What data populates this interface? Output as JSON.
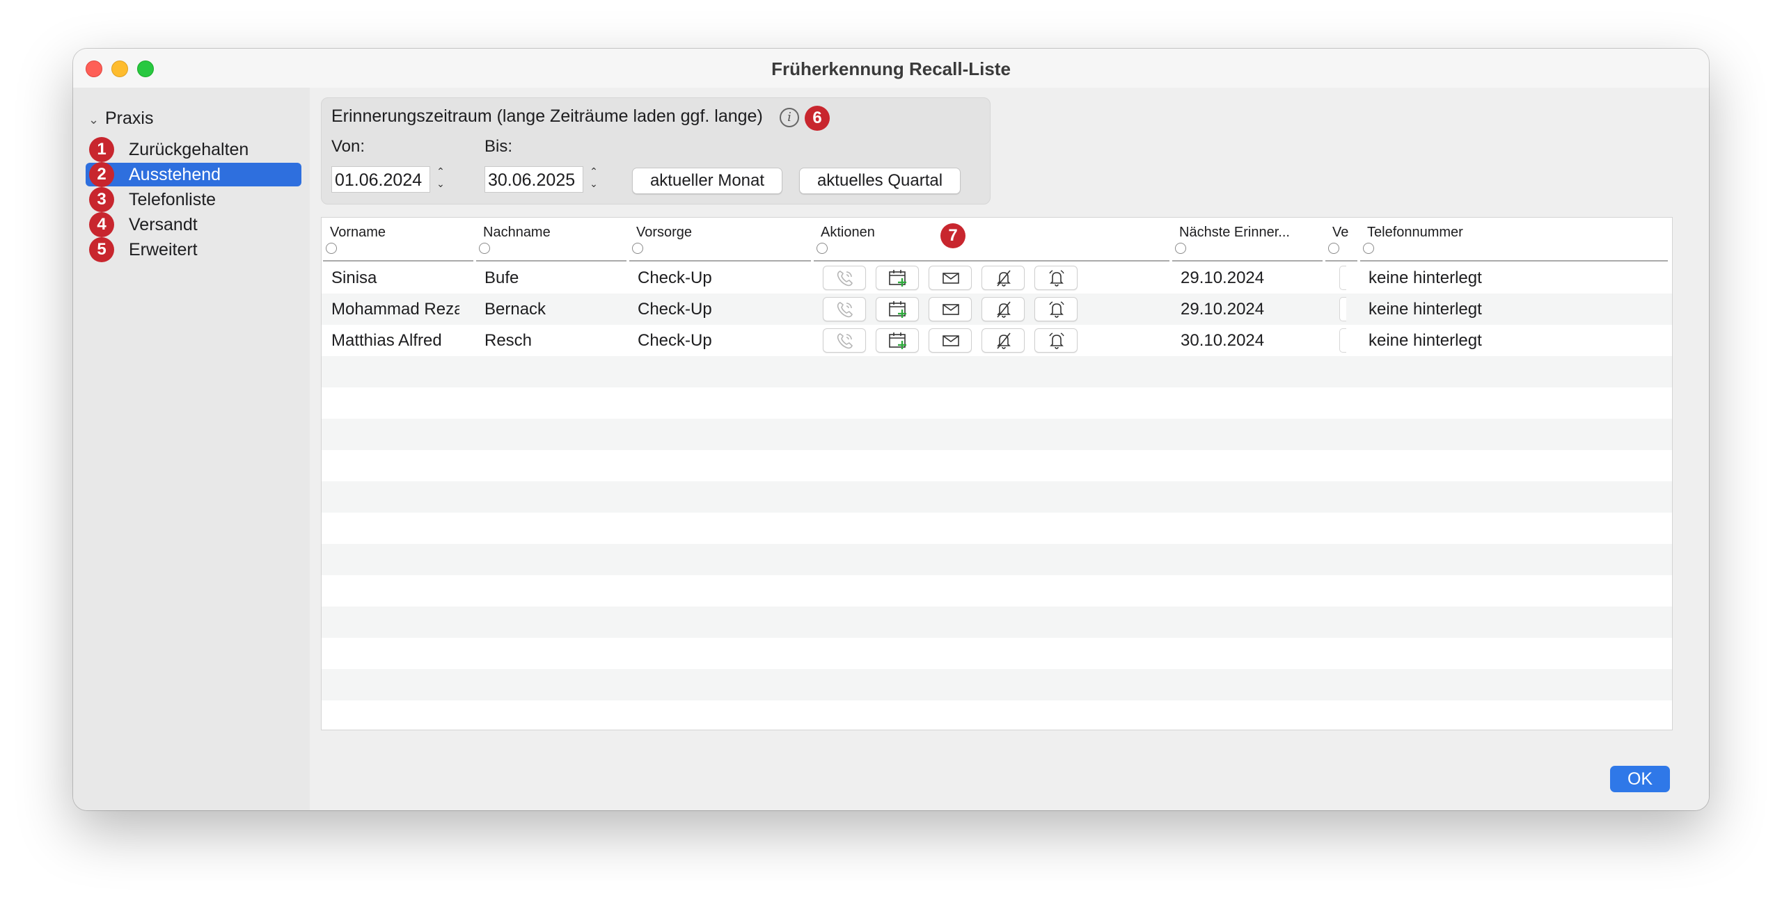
{
  "window": {
    "title": "Früherkennung Recall-Liste"
  },
  "sidebar": {
    "root": "Praxis",
    "items": [
      {
        "badge": "1",
        "label": "Zurückgehalten"
      },
      {
        "badge": "2",
        "label": "Ausstehend"
      },
      {
        "badge": "3",
        "label": "Telefonliste"
      },
      {
        "badge": "4",
        "label": "Versandt"
      },
      {
        "badge": "5",
        "label": "Erweitert"
      }
    ]
  },
  "range": {
    "title": "Erinnerungszeitraum (lange Zeiträume laden ggf. lange)",
    "info_icon": "i",
    "badge": "6",
    "von_label": "Von:",
    "bis_label": "Bis:",
    "von_value": "01.06.2024",
    "bis_value": "30.06.2025",
    "btn_month": "aktueller Monat",
    "btn_quarter": "aktuelles Quartal"
  },
  "table": {
    "badge": "7",
    "headers": {
      "vorname": "Vorname",
      "nachname": "Nachname",
      "vorsorge": "Vorsorge",
      "aktionen": "Aktionen",
      "naechste": "Nächste Erinner...",
      "v": "Ve",
      "telefon": "Telefonnummer"
    },
    "rows": [
      {
        "vorname": "Sinisa",
        "nachname": "Bufe",
        "vorsorge": "Check-Up",
        "naechste": "29.10.2024",
        "telefon": "keine hinterlegt"
      },
      {
        "vorname": "Mohammad Reza",
        "nachname": "Bernack",
        "vorsorge": "Check-Up",
        "naechste": "29.10.2024",
        "telefon": "keine hinterlegt"
      },
      {
        "vorname": "Matthias Alfred",
        "nachname": "Resch",
        "vorsorge": "Check-Up",
        "naechste": "30.10.2024",
        "telefon": "keine hinterlegt"
      }
    ],
    "action_icons": [
      "phone-icon",
      "calendar-add-icon",
      "mail-icon",
      "bell-off-icon",
      "bell-ring-icon"
    ]
  },
  "footer": {
    "ok_label": "OK"
  },
  "colors": {
    "accent": "#2e6fde",
    "badge": "#c8262e",
    "ok": "#2f78e8",
    "calendar_plus": "#2eaa3c"
  }
}
